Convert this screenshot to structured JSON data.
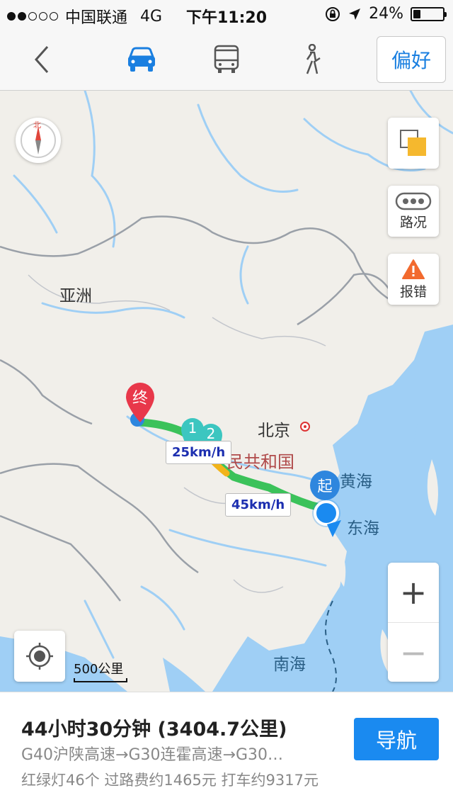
{
  "status_bar": {
    "carrier": "中国联通",
    "network": "4G",
    "time": "下午11:20",
    "battery": "24%",
    "battery_level": 0.24,
    "signal_bars": 2
  },
  "toolbar": {
    "back_icon": "chevron-left-icon",
    "modes": [
      {
        "name": "car",
        "icon": "car-icon",
        "active": true
      },
      {
        "name": "bus",
        "icon": "bus-icon",
        "active": false
      },
      {
        "name": "walk",
        "icon": "walk-icon",
        "active": false
      }
    ],
    "preference_label": "偏好",
    "accent_color": "#1a7fe0"
  },
  "map": {
    "compass_label": "北",
    "traffic_label": "路况",
    "report_label": "报错",
    "labels": {
      "asia": "亚洲",
      "beijing": "北京",
      "country": "民共和国",
      "yellow_sea": "黄海",
      "east_sea": "东海",
      "south_sea": "南海"
    },
    "start_marker": "起",
    "end_marker": "终",
    "waypoints": [
      "1",
      "2"
    ],
    "speed_labels": [
      "25km/h",
      "45km/h"
    ],
    "scale_label": "500公里",
    "zoom_in": "+",
    "zoom_out": "−",
    "route_color": "#3bc25a",
    "water_color": "#9fcff5"
  },
  "panel": {
    "summary": "44小时30分钟 (3404.7公里)",
    "route": "G40沪陕高速→G30连霍高速→G30…",
    "info": "红绿灯46个  过路费约1465元  打车约9317元",
    "navigate_label": "导航"
  }
}
